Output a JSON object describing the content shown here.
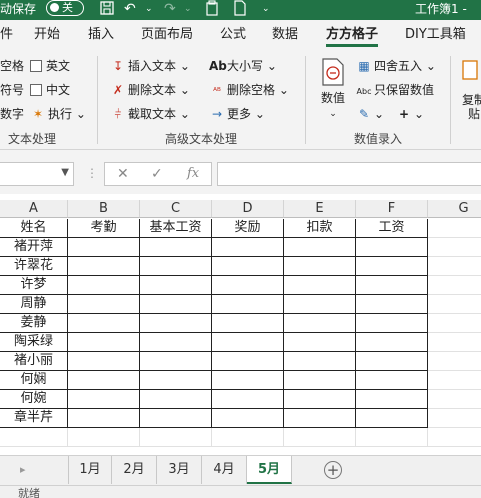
{
  "titlebar": {
    "autosave_label": "动保存",
    "autosave_state": "关",
    "doc_title": "工作簿1 -"
  },
  "tabs": [
    "件",
    "开始",
    "插入",
    "页面布局",
    "公式",
    "数据",
    "方方格子",
    "DIY工具箱"
  ],
  "active_tab": "方方格子",
  "ribbon": {
    "text_group": {
      "label": "文本处理",
      "items": [
        "空格",
        "英文",
        "符号",
        "中文",
        "数字",
        "执行"
      ]
    },
    "advanced_group": {
      "label": "高级文本处理",
      "items": [
        "插入文本",
        "删除文本",
        "截取文本",
        "大小写",
        "删除空格",
        "更多"
      ]
    },
    "numeric_group": {
      "label": "数值录入",
      "value_button": "数值",
      "round": "四舍五入",
      "keep_value": "只保留数值"
    },
    "right_cut": "复制",
    "right_cut2": "贴"
  },
  "formula_bar": {
    "fx": "fx"
  },
  "columns": [
    "A",
    "B",
    "C",
    "D",
    "E",
    "F",
    "G"
  ],
  "headers": [
    "姓名",
    "考勤",
    "基本工资",
    "奖励",
    "扣款",
    "工资"
  ],
  "names": [
    "褚开萍",
    "许翠花",
    "许梦",
    "周静",
    "姜静",
    "陶采绿",
    "褚小丽",
    "何娴",
    "何婉",
    "章半芹"
  ],
  "sheets": [
    "1月",
    "2月",
    "3月",
    "4月",
    "5月"
  ],
  "active_sheet": "5月",
  "status": "就绪"
}
